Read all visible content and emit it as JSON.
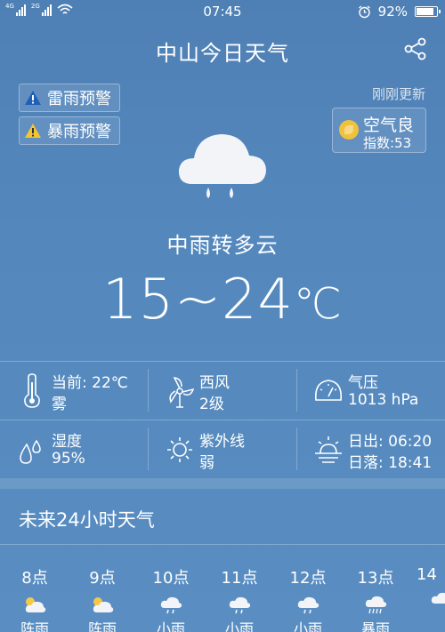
{
  "status_bar": {
    "net1": "4G",
    "net2": "2G",
    "time": "07:45",
    "battery": "92%",
    "battery_level": 0.92
  },
  "header": {
    "title": "中山今日天气"
  },
  "alerts": [
    {
      "label": "雷雨预警",
      "color": "#1f5fb8",
      "icon": "warning-icon"
    },
    {
      "label": "暴雨预警",
      "color": "#f2c531",
      "icon": "warning-icon"
    }
  ],
  "update_text": "刚刚更新",
  "air_quality": {
    "label": "空气良",
    "index_text": "指数:53"
  },
  "current": {
    "condition": "中雨转多云",
    "temp_range": "15~24",
    "unit": "℃"
  },
  "details": {
    "now": {
      "label": "当前: 22℃",
      "value": "雾"
    },
    "wind": {
      "label": "西风",
      "value": "2级"
    },
    "pressure": {
      "label": "气压",
      "value": "1013 hPa"
    },
    "humidity": {
      "label": "湿度",
      "value": "95%"
    },
    "uv": {
      "label": "紫外线",
      "value": "弱"
    },
    "sun": {
      "rise": "日出: 06:20",
      "set": "日落: 18:41"
    }
  },
  "hourly": {
    "title": "未来24小时天气",
    "items": [
      {
        "hour": "8点",
        "icon": "sun-cloud-icon",
        "desc": "阵雨"
      },
      {
        "hour": "9点",
        "icon": "sun-cloud-icon",
        "desc": "阵雨"
      },
      {
        "hour": "10点",
        "icon": "cloud-rain-icon",
        "desc": "小雨"
      },
      {
        "hour": "11点",
        "icon": "cloud-rain-icon",
        "desc": "小雨"
      },
      {
        "hour": "12点",
        "icon": "cloud-rain-icon",
        "desc": "小雨"
      },
      {
        "hour": "13点",
        "icon": "cloud-heavy-rain-icon",
        "desc": "暴雨"
      },
      {
        "hour": "14",
        "icon": "cloud-rain-icon",
        "desc": ""
      }
    ]
  }
}
